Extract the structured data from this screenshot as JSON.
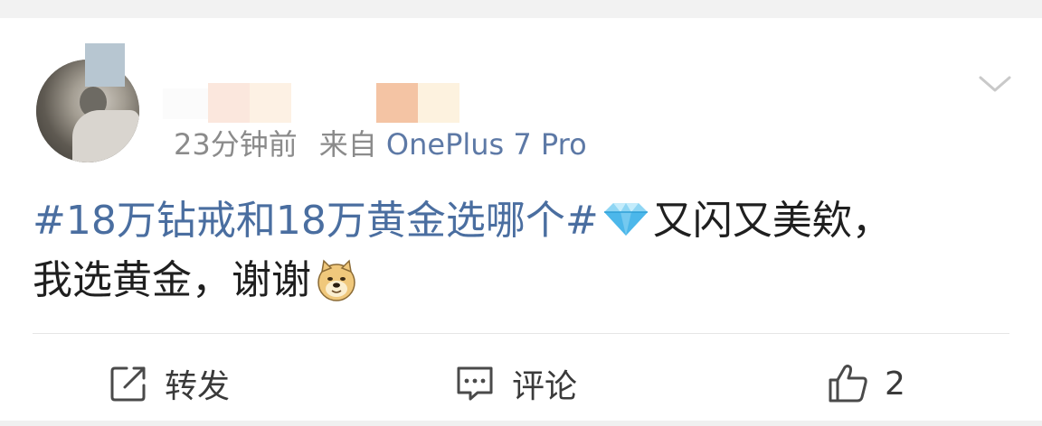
{
  "post": {
    "time": "23分钟前",
    "from_label": "来自",
    "source": "OnePlus 7 Pro",
    "content": {
      "topic": "#18万钻戒和18万黄金选哪个#",
      "emoji_1": "diamond",
      "text_line_1": "又闪又美欸，",
      "text_line_2": "我选黄金，谢谢",
      "emoji_2": "doge"
    }
  },
  "actions": {
    "repost_label": "转发",
    "comment_label": "评论",
    "like_count": "2"
  },
  "colors": {
    "link": "#4a6ea0",
    "meta": "#8b8b8b",
    "source": "#5d79a6",
    "text": "#1f1f1f"
  }
}
